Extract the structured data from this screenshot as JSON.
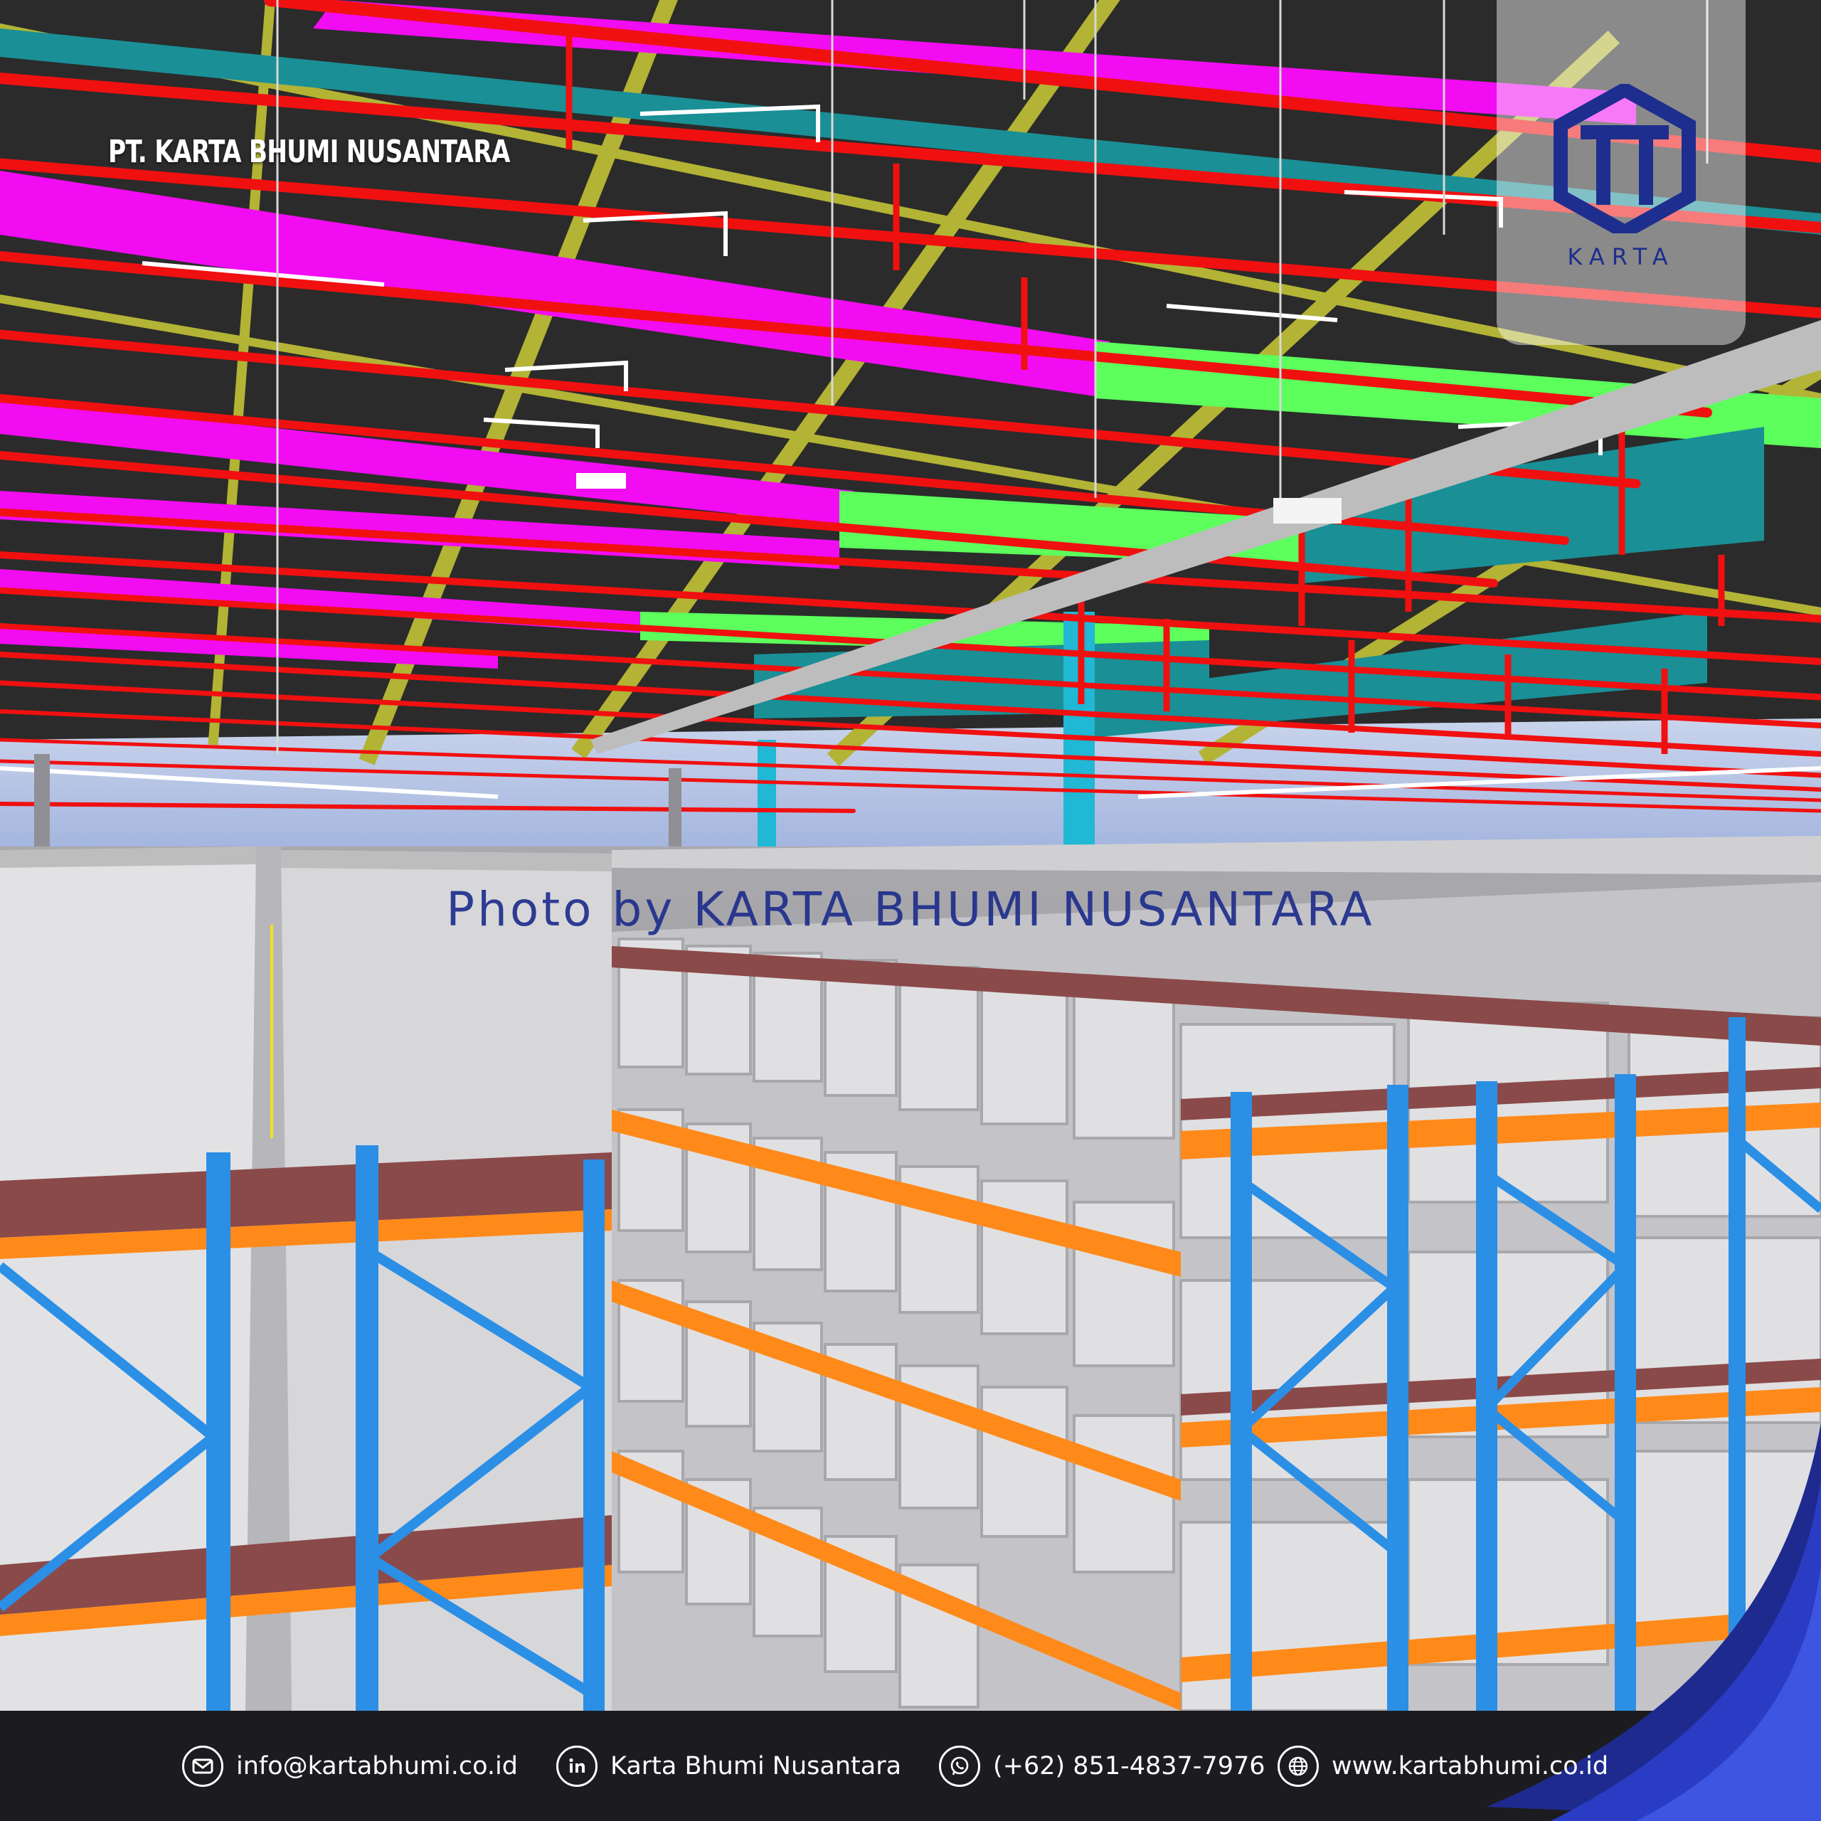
{
  "company_name": "PT. KARTA BHUMI NUSANTARA",
  "watermark": "Photo by KARTA BHUMI NUSANTARA",
  "logo": {
    "wordmark": "KARTA",
    "color": "#1e2e8e"
  },
  "contacts": [
    {
      "icon": "email-icon",
      "text": "info@kartabhumi.co.id"
    },
    {
      "icon": "linkedin-icon",
      "text": "Karta Bhumi Nusantara"
    },
    {
      "icon": "whatsapp-icon",
      "text": "(+62) 851-4837-7976"
    },
    {
      "icon": "globe-icon",
      "text": "www.kartabhumi.co.id"
    }
  ],
  "colors": {
    "pipe_red": "#f01010",
    "duct_magenta": "#f20cf2",
    "duct_green": "#5cff5c",
    "duct_teal": "#1a8f96",
    "truss_olive": "#b3b335",
    "rack_blue": "#2b8fe6",
    "beam_orange": "#ff8a1a",
    "footer": "#1c1c20"
  }
}
